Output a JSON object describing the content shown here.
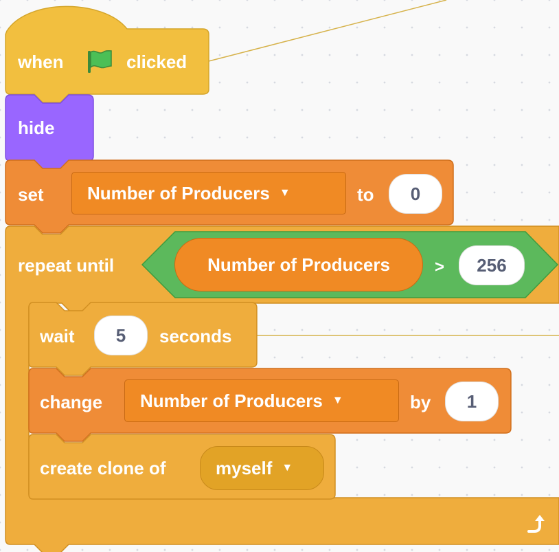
{
  "app": "Scratch",
  "colors": {
    "events": "#f2bf3f",
    "looks": "#9966ff",
    "variables": "#ef8c37",
    "control": "#efad3d",
    "operators": "#5cb95c",
    "input_text": "#575e75"
  },
  "script": {
    "hat": {
      "when_text": "when",
      "flag_icon": "green-flag-icon",
      "clicked_text": "clicked"
    },
    "hide": {
      "label": "hide"
    },
    "set": {
      "label": "set",
      "variable": "Number of Producers",
      "dropdown_icon": "▼",
      "to_text": "to",
      "value": "0"
    },
    "repeat_until": {
      "label": "repeat until",
      "condition": {
        "variable": "Number of Producers",
        "operator": ">",
        "value": "256"
      },
      "loop_icon": "repeat-arrow-icon"
    },
    "wait": {
      "label": "wait",
      "value": "5",
      "unit": "seconds"
    },
    "change": {
      "label": "change",
      "variable": "Number of Producers",
      "dropdown_icon": "▼",
      "by_text": "by",
      "value": "1"
    },
    "create_clone": {
      "label": "create clone of",
      "target": "myself",
      "dropdown_icon": "▼"
    }
  }
}
